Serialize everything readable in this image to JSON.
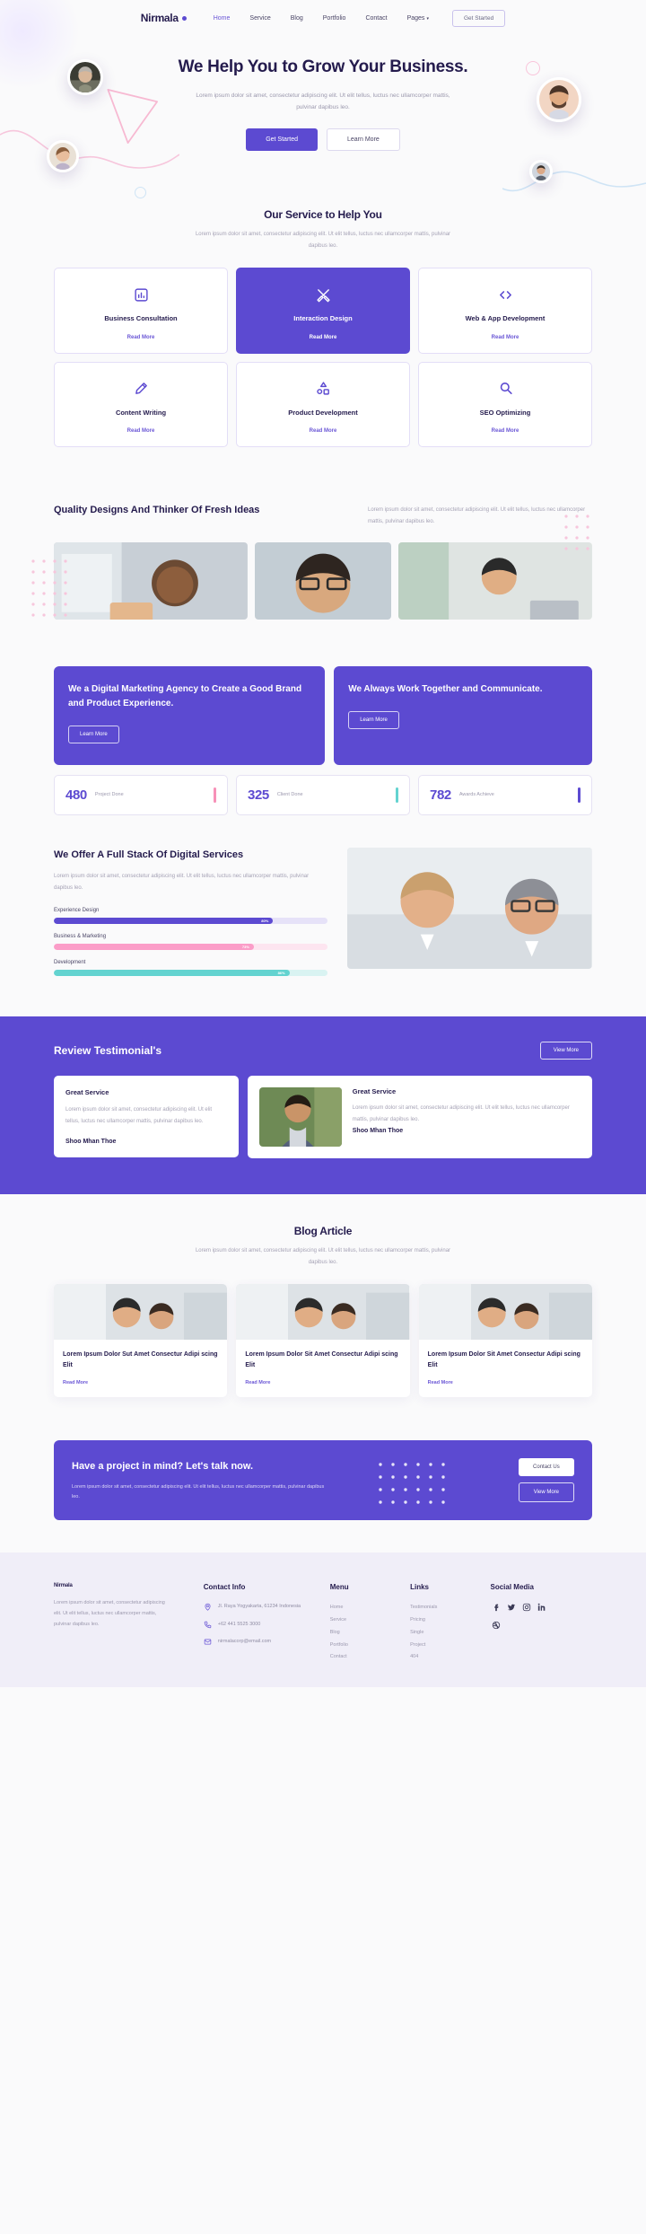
{
  "nav": {
    "brand": "Nirmala",
    "links": [
      {
        "label": "Home",
        "active": true
      },
      {
        "label": "Service",
        "active": false
      },
      {
        "label": "Blog",
        "active": false
      },
      {
        "label": "Portfolio",
        "active": false
      },
      {
        "label": "Contact",
        "active": false
      },
      {
        "label": "Pages",
        "active": false,
        "caret": true
      }
    ],
    "cta": "Get Started"
  },
  "hero": {
    "title": "We Help You to Grow Your Business.",
    "desc": "Lorem ipsum dolor sit amet, consectetur adipiscing elit. Ut elit tellus, luctus nec ullamcorper mattis, pulvinar dapibus leo.",
    "primary": "Get Started",
    "secondary": "Learn More"
  },
  "services": {
    "title": "Our Service to Help You",
    "desc": "Lorem ipsum dolor sit amet, consectetur adipiscing elit. Ut elit tellus, luctus nec ullamcorper mattis, pulvinar dapibus leo.",
    "read_more": "Read More",
    "items": [
      {
        "title": "Business Consultation",
        "icon": "chart-bar-icon",
        "active": false
      },
      {
        "title": "Interaction Design",
        "icon": "pen-ruler-icon",
        "active": true
      },
      {
        "title": "Web & App Development",
        "icon": "code-brackets-icon",
        "active": false
      },
      {
        "title": "Content Writing",
        "icon": "pencil-write-icon",
        "active": false
      },
      {
        "title": "Product Development",
        "icon": "shapes-icon",
        "active": false
      },
      {
        "title": "SEO Optimizing",
        "icon": "magnifier-icon",
        "active": false
      }
    ]
  },
  "quality": {
    "title": "Quality Designs And Thinker Of Fresh Ideas",
    "desc": "Lorem ipsum dolor sit amet, consectetur adipiscing elit. Ut elit tellus, luctus nec ullamcorper mattis, pulvinar dapibus leo."
  },
  "promo": {
    "cards": [
      {
        "title": "We a Digital Marketing Agency to Create a Good Brand and Product Experience.",
        "button": "Learn More"
      },
      {
        "title": "We Always Work Together and Communicate.",
        "button": "Learn More"
      }
    ],
    "stats": [
      {
        "number": "480",
        "label": "Project Done",
        "color": "#f791b8"
      },
      {
        "number": "325",
        "label": "Client Done",
        "color": "#63d3d0"
      },
      {
        "number": "782",
        "label": "Awards Achieve",
        "color": "#5c4ad1"
      }
    ]
  },
  "skills": {
    "title": "We Offer A Full Stack Of Digital Services",
    "desc": "Lorem ipsum dolor sit amet, consectetur adipiscing elit. Ut elit tellus, luctus nec ullamcorper mattis, pulvinar dapibus leo.",
    "bars": [
      {
        "name": "Experience Design",
        "value": 80,
        "label": "80%",
        "color": "#5c4ad1",
        "track": "#e6e2f8"
      },
      {
        "name": "Business & Marketing",
        "value": 73,
        "label": "73%",
        "color": "#fb9dc8",
        "track": "#fde5f0"
      },
      {
        "name": "Development",
        "value": 86,
        "label": "86%",
        "color": "#63d3d0",
        "track": "#d9f3f2"
      }
    ]
  },
  "testimonials": {
    "title": "Review Testimonial's",
    "view_more": "View More",
    "card": {
      "heading": "Great Service",
      "text": "Lorem ipsum dolor sit amet, consectetur adipiscing elit. Ut elit tellus, luctus nec ullamcorper mattis, pulvinar dapibus leo.",
      "author": "Shoo Mhan Thoe"
    },
    "wide": {
      "heading": "Great Service",
      "text": "Lorem ipsum dolor sit amet, consectetur adipiscing elit. Ut elit tellus, luctus nec ullamcorper mattis, pulvinar dapibus leo.",
      "author": "Shoo Mhan Thoe"
    }
  },
  "blog": {
    "title": "Blog Article",
    "desc": "Lorem ipsum dolor sit amet, consectetur adipiscing elit. Ut elit tellus, luctus nec ullamcorper mattis, pulvinar dapibus leo.",
    "read_more": "Read More",
    "posts": [
      {
        "title": "Lorem Ipsum Dolor Sut Amet Consectur Adipi scing Elit"
      },
      {
        "title": "Lorem Ipsum Dolor Sit Amet Consectur Adipi scing Elit"
      },
      {
        "title": "Lorem Ipsum Dolor Sit Amet Consectur Adipi scing Elit"
      }
    ]
  },
  "cta": {
    "title": "Have a project in mind? Let's talk now.",
    "desc": "Lorem ipsum dolor sit amet, consectetur adipiscing elit. Ut elit tellus, luctus nec ullamcorper mattis, pulvinar dapibus leo.",
    "primary": "Contact Us",
    "secondary": "View More"
  },
  "footer": {
    "brand": "Nirmala",
    "about": "Lorem ipsum dolor sit amet, consectetur adipiscing elit. Ut elit tellus, luctus nec ullamcorper mattis, pulvinar dapibus leo.",
    "contact": {
      "title": "Contact Info",
      "address": "Jl. Raya Yogyakarta, 61234 Indonesia",
      "phone": "+62 441 5525 3000",
      "email": "nirmalacorp@email.com"
    },
    "menu": {
      "title": "Menu",
      "items": [
        "Home",
        "Service",
        "Blog",
        "Portfolio",
        "Contact"
      ]
    },
    "links": {
      "title": "Links",
      "items": [
        "Testimonials",
        "Pricing",
        "Single",
        "Project",
        "404"
      ]
    },
    "social": {
      "title": "Social Media",
      "icons": [
        "facebook-icon",
        "twitter-icon",
        "instagram-icon",
        "linkedin-icon",
        "dribbble-icon"
      ]
    }
  },
  "colors": {
    "accent": "#5c4ad1",
    "dark": "#241b4d",
    "muted": "#a5a2b5",
    "pink": "#fb9dc8",
    "teal": "#63d3d0",
    "page_bg": "#fafafb",
    "footer_bg": "#f0eef8"
  }
}
